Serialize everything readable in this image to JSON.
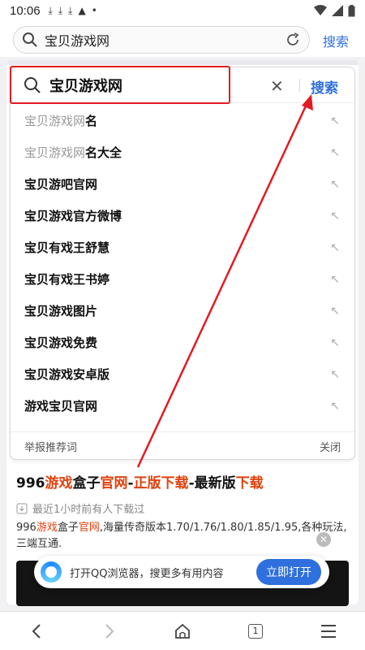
{
  "status": {
    "time": "10:06"
  },
  "url_bar": {
    "text": "宝贝游戏网",
    "search_link": "搜索"
  },
  "suggest": {
    "query": "宝贝游戏网",
    "search_button": "搜索",
    "items": [
      {
        "prefix": "宝贝游戏网",
        "bold": "名"
      },
      {
        "prefix": "宝贝游戏网",
        "bold": "名大全"
      },
      {
        "prefix": "",
        "bold": "宝贝游吧官网"
      },
      {
        "prefix": "",
        "bold": "宝贝游戏官方微博"
      },
      {
        "prefix": "",
        "bold": "宝贝有戏王舒慧"
      },
      {
        "prefix": "",
        "bold": "宝贝有戏王书婷"
      },
      {
        "prefix": "",
        "bold": "宝贝游戏图片"
      },
      {
        "prefix": "",
        "bold": "宝贝游戏免费"
      },
      {
        "prefix": "",
        "bold": "宝贝游戏安卓版"
      },
      {
        "prefix": "",
        "bold": "游戏宝贝官网"
      }
    ],
    "footer_report": "举报推荐词",
    "footer_close": "关闭"
  },
  "result": {
    "title_parts": [
      "996",
      "游戏",
      "盒子",
      "官网",
      "-",
      "正版下载",
      "-最新版",
      "下载"
    ],
    "meta": "最近1小时前有人下载过",
    "snippet_parts": [
      "996",
      "游戏",
      "盒子",
      "官网",
      ",海量传奇版本1.70/1.76/1.80/1.85/1.95,各种玩法,三端互通."
    ]
  },
  "qq_banner": {
    "text": "打开QQ浏览器，搜更多有用内容",
    "button": "立即打开"
  },
  "bottom_nav": {
    "tab_count": "1"
  },
  "colors": {
    "accent": "#2f6fde",
    "highlight": "#e0400c",
    "annotation": "#e21b23"
  }
}
